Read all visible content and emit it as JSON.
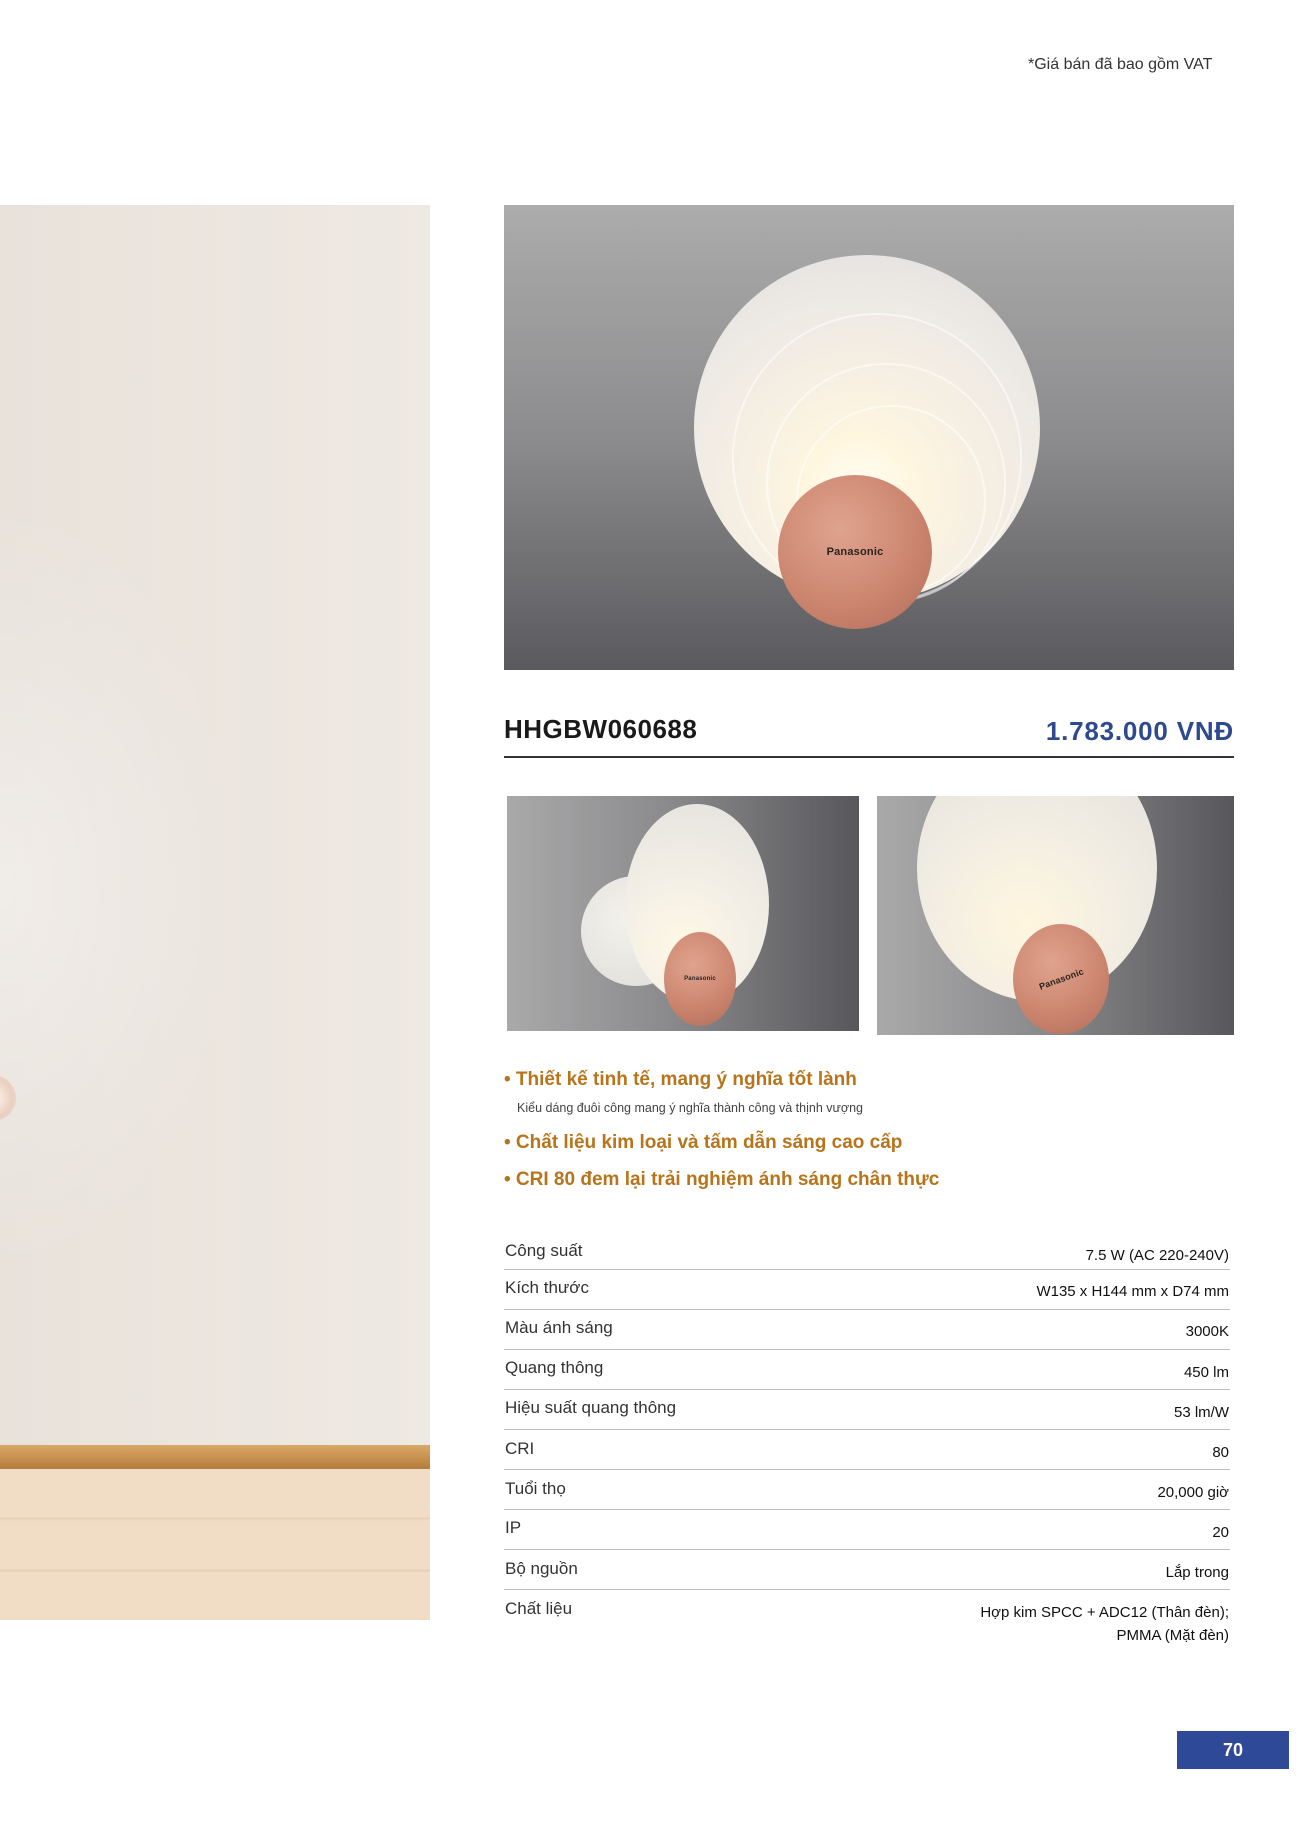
{
  "header": {
    "vat_note": "*Giá bán đã bao gồm VAT"
  },
  "product": {
    "model": "HHGBW060688",
    "price": "1.783.000  VNĐ",
    "brand": "Panasonic"
  },
  "features": [
    {
      "title": "• Thiết kế tinh tế, mang ý nghĩa tốt lành",
      "subtitle": "Kiểu dáng đuôi công mang ý nghĩa thành công và thịnh vượng"
    },
    {
      "title": "• Chất liệu kim loại và tấm dẫn sáng cao cấp"
    },
    {
      "title": "• CRI 80 đem lại trải nghiệm ánh sáng chân thực"
    }
  ],
  "specs": [
    {
      "label": "Công suất",
      "value": "7.5 W (AC 220-240V)"
    },
    {
      "label": "Kích thước",
      "value": "W135 x H144 mm x D74 mm"
    },
    {
      "label": "Màu ánh sáng",
      "value": "3000K"
    },
    {
      "label": "Quang thông",
      "value": "450 lm"
    },
    {
      "label": "Hiệu suất quang thông",
      "value": "53 lm/W"
    },
    {
      "label": "CRI",
      "value": "80"
    },
    {
      "label": "Tuổi thọ",
      "value": "20,000 giờ"
    },
    {
      "label": "IP",
      "value": "20"
    },
    {
      "label": "Bộ nguồn",
      "value": "Lắp trong"
    },
    {
      "label": "Chất liệu",
      "value_line1": "Hợp kim SPCC + ADC12 (Thân đèn);",
      "value_line2": "PMMA (Mặt đèn)"
    }
  ],
  "footer": {
    "page_number": "70"
  },
  "colors": {
    "accent_blue": "#2d4a91",
    "feature_orange": "#b8741a",
    "page_badge": "#2f4999"
  }
}
